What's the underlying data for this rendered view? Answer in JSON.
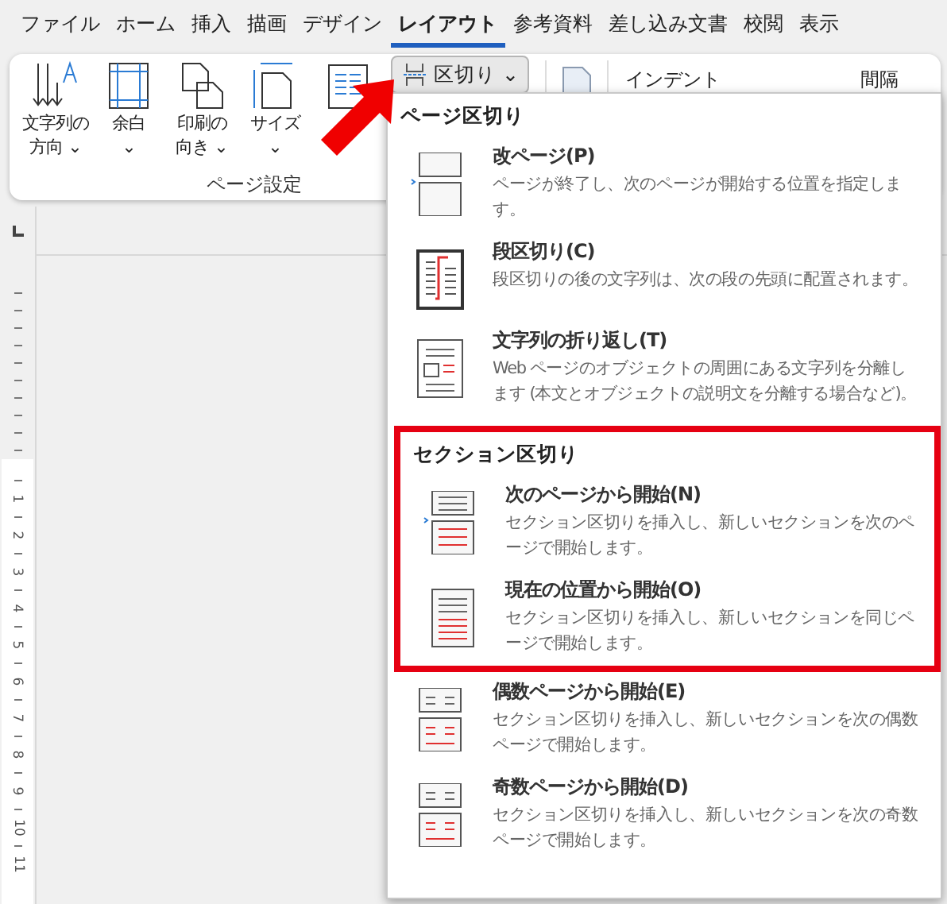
{
  "tabs": [
    {
      "label": "ファイル",
      "selected": false
    },
    {
      "label": "ホーム",
      "selected": false
    },
    {
      "label": "挿入",
      "selected": false
    },
    {
      "label": "描画",
      "selected": false
    },
    {
      "label": "デザイン",
      "selected": false
    },
    {
      "label": "レイアウト",
      "selected": true
    },
    {
      "label": "参考資料",
      "selected": false
    },
    {
      "label": "差し込み文書",
      "selected": false
    },
    {
      "label": "校閲",
      "selected": false
    },
    {
      "label": "表示",
      "selected": false
    }
  ],
  "ribbon": {
    "buttons": [
      {
        "kind": "direction",
        "lines": [
          "文字列の",
          "方向 ⌄"
        ]
      },
      {
        "kind": "margins",
        "lines": [
          "余白",
          "⌄"
        ]
      },
      {
        "kind": "orientation",
        "lines": [
          "印刷の",
          "向き ⌄"
        ]
      },
      {
        "kind": "size",
        "lines": [
          "サイズ",
          "⌄"
        ]
      },
      {
        "kind": "columns"
      }
    ],
    "breaks_button": {
      "label": "区切り ⌄",
      "expanded": true
    },
    "group_label": "ページ設定",
    "indent_label": "インデント",
    "spacing_label": "間隔"
  },
  "ruler": {
    "numbers": [
      "1",
      "2",
      "3",
      "4",
      "5",
      "6",
      "7",
      "8",
      "9",
      "10",
      "11"
    ]
  },
  "menu": {
    "sections": [
      {
        "header": "ページ区切り",
        "items": [
          {
            "kind": "page",
            "title": "改ページ(P)",
            "description": "ページが終了し、次のページが開始する位置を指定します。",
            "highlighted": false
          },
          {
            "kind": "column",
            "title": "段区切り(C)",
            "description": "段区切りの後の文字列は、次の段の先頭に配置されます。",
            "highlighted": false
          },
          {
            "kind": "wrap",
            "title": "文字列の折り返し(T)",
            "description": "Web ページのオブジェクトの周囲にある文字列を分離します (本文とオブジェクトの説明文を分離する場合など)。",
            "highlighted": false
          }
        ]
      },
      {
        "header": "セクション区切り",
        "items": [
          {
            "kind": "next_page",
            "title": "次のページから開始(N)",
            "description": "セクション区切りを挿入し、新しいセクションを次のページで開始します。",
            "highlighted": true
          },
          {
            "kind": "continuous",
            "title": "現在の位置から開始(O)",
            "description": "セクション区切りを挿入し、新しいセクションを同じページで開始します。",
            "highlighted": true
          },
          {
            "kind": "even",
            "title": "偶数ページから開始(E)",
            "description": "セクション区切りを挿入し、新しいセクションを次の偶数ページで開始します。",
            "highlighted": false
          },
          {
            "kind": "odd",
            "title": "奇数ページから開始(D)",
            "description": "セクション区切りを挿入し、新しいセクションを次の奇数ページで開始します。",
            "highlighted": false
          }
        ]
      }
    ]
  }
}
